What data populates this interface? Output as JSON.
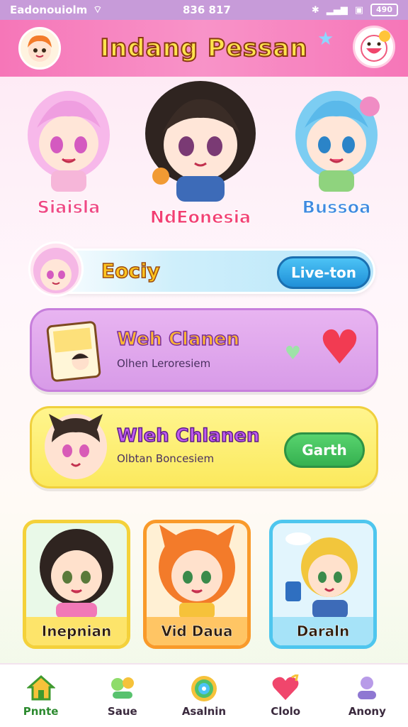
{
  "status_bar": {
    "carrier": "Eadonouiolm",
    "time": "836 817",
    "battery": "490"
  },
  "header": {
    "title": "Indang Pessan"
  },
  "characters": [
    {
      "name": "Siaisla",
      "color": "#ef4a86"
    },
    {
      "name": "NdEonesia",
      "color": "#f23f73"
    },
    {
      "name": "Bussoa",
      "color": "#3f8ae0"
    }
  ],
  "banner": {
    "title": "Eociy",
    "button_label": "Live-ton"
  },
  "cards": [
    {
      "title": "Weh Clanen",
      "subtitle": "Olhen Leroresiem"
    },
    {
      "title": "Wleh Chlanen",
      "subtitle": "Olbtan Boncesiem",
      "button_label": "Garth"
    }
  ],
  "tiles": [
    {
      "label": "Inepnian"
    },
    {
      "label": "Vid Daua"
    },
    {
      "label": "Daraln"
    }
  ],
  "bottom_nav": [
    {
      "label": "Pnnte",
      "icon": "home-icon"
    },
    {
      "label": "Saue",
      "icon": "friends-icon"
    },
    {
      "label": "Asalnin",
      "icon": "target-icon"
    },
    {
      "label": "Clolo",
      "icon": "heart-icon"
    },
    {
      "label": "Anony",
      "icon": "profile-icon"
    }
  ],
  "colors": {
    "header": "#f676b8",
    "accent_blue": "#1f8fd8",
    "accent_green": "#35b150",
    "card_purple": "#d89be8",
    "card_yellow": "#fbe95d"
  }
}
